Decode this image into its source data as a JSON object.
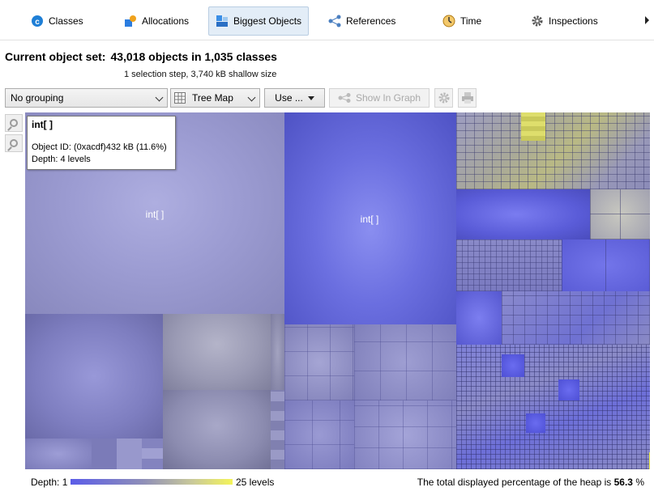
{
  "tabs": [
    {
      "label": "Classes",
      "icon": "class-icon",
      "active": false
    },
    {
      "label": "Allocations",
      "icon": "allocations-icon",
      "active": false
    },
    {
      "label": "Biggest Objects",
      "icon": "biggest-objects-icon",
      "active": true
    },
    {
      "label": "References",
      "icon": "references-icon",
      "active": false
    },
    {
      "label": "Time",
      "icon": "clock-icon",
      "active": false
    },
    {
      "label": "Inspections",
      "icon": "gear-icon",
      "active": false
    }
  ],
  "header": {
    "title_label": "Current object set:",
    "title_value": "43,018 objects in 1,035 classes",
    "subtitle": "1 selection step, 3,740 kB shallow size"
  },
  "toolbar": {
    "grouping": "No grouping",
    "view_mode": "Tree Map",
    "use_label": "Use ...",
    "show_in_graph": "Show In Graph"
  },
  "treemap": {
    "labels": [
      "int[ ]",
      "int[ ]"
    ]
  },
  "tooltip": {
    "title": "int[ ]",
    "object_line": "Object ID: (0xacdf)432 kB (11.6%)",
    "depth_line": "Depth: 4 levels"
  },
  "footer": {
    "depth_start": "Depth: 1",
    "depth_end": "25 levels",
    "heap_text": "The total displayed percentage of the heap is",
    "heap_percent": "56.3",
    "heap_unit": "%"
  },
  "colors": {
    "tab_active_bg": "#e3edf7",
    "depth_low": "#5b5de8",
    "depth_high": "#f4f45a"
  }
}
